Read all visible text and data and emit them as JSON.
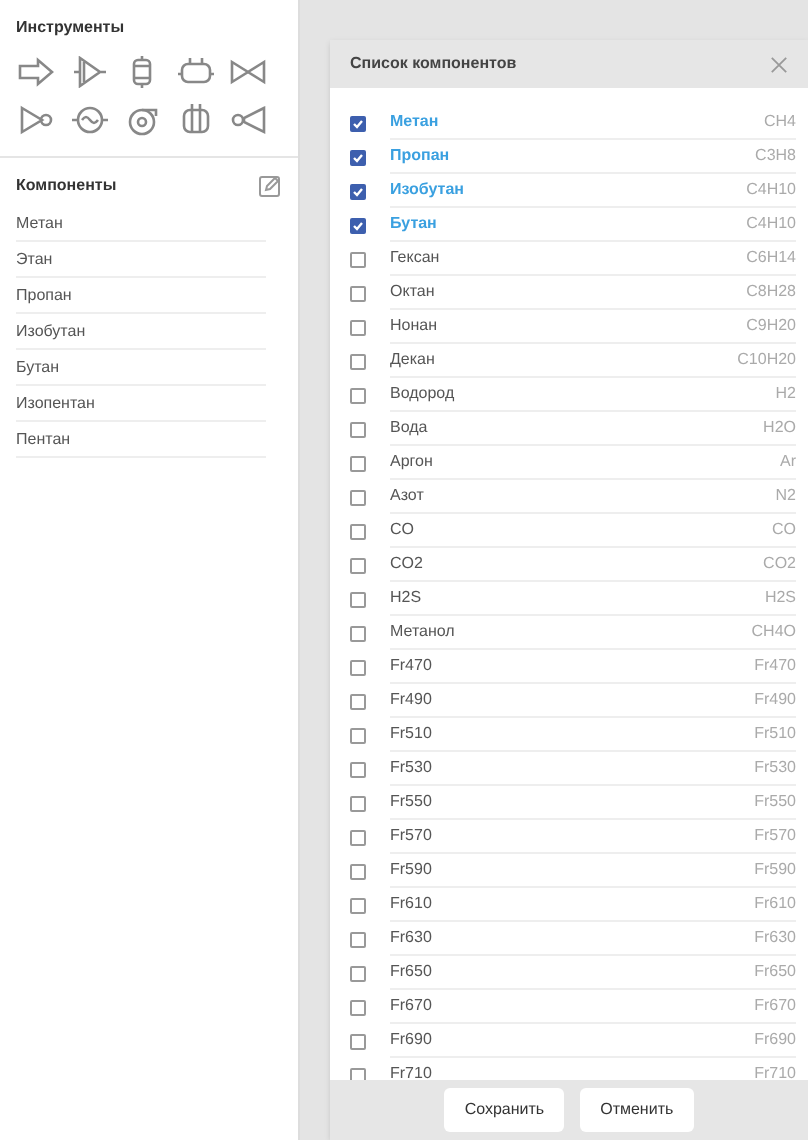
{
  "tools": {
    "title": "Инструменты"
  },
  "components": {
    "title": "Компоненты",
    "items": [
      "Метан",
      "Этан",
      "Пропан",
      "Изобутан",
      "Бутан",
      "Изопентан",
      "Пентан"
    ]
  },
  "dialog": {
    "title": "Список компонентов",
    "rows": [
      {
        "name": "Метан",
        "formula": "CH4",
        "checked": true
      },
      {
        "name": "Пропан",
        "formula": "C3H8",
        "checked": true
      },
      {
        "name": "Изобутан",
        "formula": "C4H10",
        "checked": true
      },
      {
        "name": "Бутан",
        "formula": "C4H10",
        "checked": true
      },
      {
        "name": "Гексан",
        "formula": "C6H14",
        "checked": false
      },
      {
        "name": "Октан",
        "formula": "C8H28",
        "checked": false
      },
      {
        "name": "Нонан",
        "formula": "C9H20",
        "checked": false
      },
      {
        "name": "Декан",
        "formula": "C10H20",
        "checked": false
      },
      {
        "name": "Водород",
        "formula": "H2",
        "checked": false
      },
      {
        "name": "Вода",
        "formula": "H2O",
        "checked": false
      },
      {
        "name": "Аргон",
        "formula": "Ar",
        "checked": false
      },
      {
        "name": "Азот",
        "formula": "N2",
        "checked": false
      },
      {
        "name": "CO",
        "formula": "CO",
        "checked": false
      },
      {
        "name": "CO2",
        "formula": "CO2",
        "checked": false
      },
      {
        "name": "H2S",
        "formula": "H2S",
        "checked": false
      },
      {
        "name": "Метанол",
        "formula": "CH4O",
        "checked": false
      },
      {
        "name": "Fr470",
        "formula": "Fr470",
        "checked": false
      },
      {
        "name": "Fr490",
        "formula": "Fr490",
        "checked": false
      },
      {
        "name": "Fr510",
        "formula": "Fr510",
        "checked": false
      },
      {
        "name": "Fr530",
        "formula": "Fr530",
        "checked": false
      },
      {
        "name": "Fr550",
        "formula": "Fr550",
        "checked": false
      },
      {
        "name": "Fr570",
        "formula": "Fr570",
        "checked": false
      },
      {
        "name": "Fr590",
        "formula": "Fr590",
        "checked": false
      },
      {
        "name": "Fr610",
        "formula": "Fr610",
        "checked": false
      },
      {
        "name": "Fr630",
        "formula": "Fr630",
        "checked": false
      },
      {
        "name": "Fr650",
        "formula": "Fr650",
        "checked": false
      },
      {
        "name": "Fr670",
        "formula": "Fr670",
        "checked": false
      },
      {
        "name": "Fr690",
        "formula": "Fr690",
        "checked": false
      },
      {
        "name": "Fr710",
        "formula": "Fr710",
        "checked": false
      }
    ],
    "buttons": [
      "Сохранить",
      "Отменить"
    ]
  }
}
